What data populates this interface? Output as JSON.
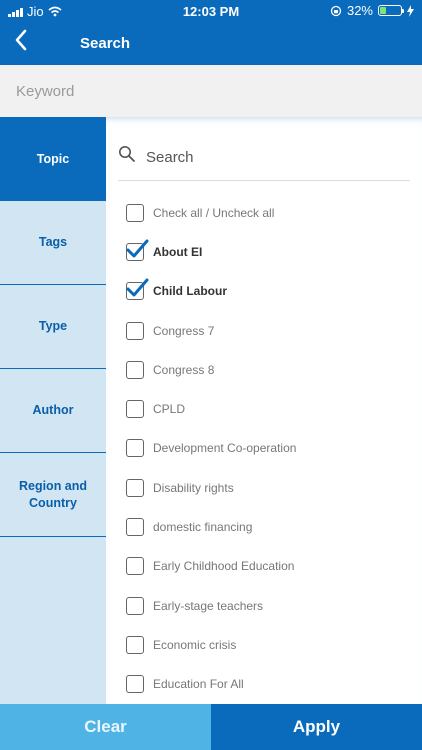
{
  "status_bar": {
    "carrier": "Jio",
    "time": "12:03 PM",
    "battery_percent": "32%",
    "battery_level": 0.32
  },
  "header": {
    "title": "Search",
    "back_icon": "chevron-left-icon"
  },
  "keyword": {
    "placeholder": "Keyword"
  },
  "sidebar": {
    "items": [
      {
        "label": "Topic",
        "active": true
      },
      {
        "label": "Tags",
        "active": false
      },
      {
        "label": "Type",
        "active": false
      },
      {
        "label": "Author",
        "active": false
      },
      {
        "label": "Region and Country",
        "active": false
      }
    ]
  },
  "filter": {
    "search_placeholder": "Search",
    "options": [
      {
        "label": "Check all / Uncheck all",
        "checked": false
      },
      {
        "label": "About EI",
        "checked": true
      },
      {
        "label": "Child Labour",
        "checked": true
      },
      {
        "label": "Congress 7",
        "checked": false
      },
      {
        "label": "Congress 8",
        "checked": false
      },
      {
        "label": "CPLD",
        "checked": false
      },
      {
        "label": "Development Co-operation",
        "checked": false
      },
      {
        "label": "Disability rights",
        "checked": false
      },
      {
        "label": "domestic financing",
        "checked": false
      },
      {
        "label": "Early Childhood Education",
        "checked": false
      },
      {
        "label": "Early-stage teachers",
        "checked": false
      },
      {
        "label": "Economic crisis",
        "checked": false
      },
      {
        "label": "Education For All",
        "checked": false
      }
    ]
  },
  "actions": {
    "clear_label": "Clear",
    "apply_label": "Apply"
  },
  "colors": {
    "primary": "#0a6bbd",
    "sidebar_bg": "#d1e5f3",
    "clear_bg": "#4fb3e6",
    "checkbox_check": "#0a6bbd"
  }
}
